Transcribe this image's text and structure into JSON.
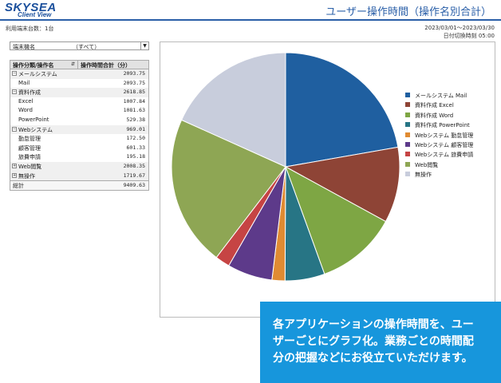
{
  "header": {
    "logo_main": "SKYSEA",
    "logo_sub": "Client View",
    "title": "ユーザー操作時間（操作名別合計）"
  },
  "info": {
    "terminal_count": "利用端末台数：1台",
    "date_range": "2023/03/01～2023/03/30",
    "day_switch": "日付切換時刻 05:00"
  },
  "filter": {
    "label": "端末機名",
    "value": "（すべて）",
    "arrow_icon": "chevron-down-icon"
  },
  "table": {
    "col1": "操作分類/操作名",
    "col2": "操作時間合計（分）",
    "rows": [
      {
        "kind": "group",
        "toggle": "⊟",
        "label": "メールシステム",
        "value": "2093.75"
      },
      {
        "kind": "child",
        "label": "Mail",
        "value": "2093.75"
      },
      {
        "kind": "group",
        "toggle": "⊟",
        "label": "資料作成",
        "value": "2618.85"
      },
      {
        "kind": "child",
        "label": "Excel",
        "value": "1007.84"
      },
      {
        "kind": "child",
        "label": "Word",
        "value": "1081.63"
      },
      {
        "kind": "child",
        "label": "PowerPoint",
        "value": "529.38"
      },
      {
        "kind": "group",
        "toggle": "⊟",
        "label": "Webシステム",
        "value": "969.01"
      },
      {
        "kind": "child",
        "label": "勤怠管理",
        "value": "172.50"
      },
      {
        "kind": "child",
        "label": "顧客管理",
        "value": "601.33"
      },
      {
        "kind": "child",
        "label": "旅費申請",
        "value": "195.18"
      },
      {
        "kind": "group",
        "toggle": "⊞",
        "label": "Web閲覧",
        "value": "2008.35"
      },
      {
        "kind": "group",
        "toggle": "⊞",
        "label": "無操作",
        "value": "1719.67"
      }
    ],
    "total_label": "総計",
    "total_value": "9409.63"
  },
  "chart_data": {
    "type": "pie",
    "slices": [
      {
        "name": "メールシステム Mail",
        "value": 2093.75,
        "color": "#1f5fa0"
      },
      {
        "name": "資料作成 Excel",
        "value": 1007.84,
        "color": "#8e4436"
      },
      {
        "name": "資料作成 Word",
        "value": 1081.63,
        "color": "#7ea644"
      },
      {
        "name": "資料作成 PowerPoint",
        "value": 529.38,
        "color": "#277585"
      },
      {
        "name": "Webシステム 勤怠管理",
        "value": 172.5,
        "color": "#e08b32"
      },
      {
        "name": "Webシステム 顧客管理",
        "value": 601.33,
        "color": "#5d3a8a"
      },
      {
        "name": "Webシステム 旅費申請",
        "value": 195.18,
        "color": "#c64444"
      },
      {
        "name": "Web閲覧",
        "value": 2008.35,
        "color": "#8ea654"
      },
      {
        "name": "無操作",
        "value": 1719.67,
        "color": "#c8cddc"
      }
    ],
    "legend_position": "right"
  },
  "promo": {
    "line1": "各アプリケーションの操作時間を、ユー",
    "line2": "ザーごとにグラフ化。業務ごとの時間配",
    "line3": "分の把握などにお役立ていただけます。"
  }
}
